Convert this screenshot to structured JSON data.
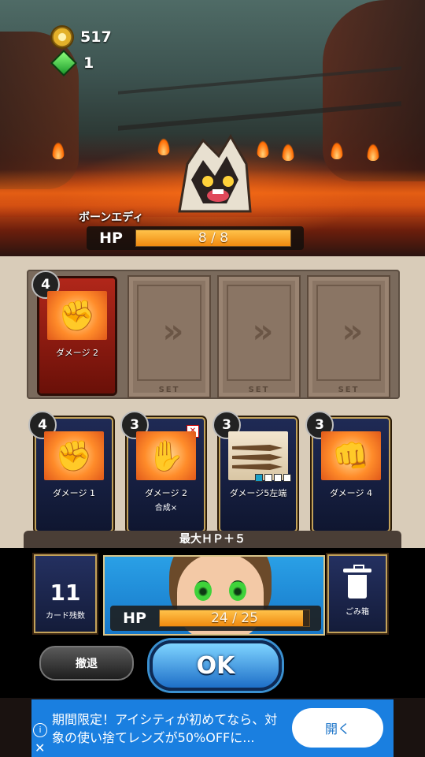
{
  "resources": {
    "coins": "517",
    "gems": "1"
  },
  "enemy": {
    "name": "ボーンエディ",
    "hp_label": "HP",
    "hp_text": "8 / 8",
    "hp_fraction": 1.0
  },
  "slots": {
    "filled": {
      "cost": "4",
      "label": "ダメージ 2",
      "icon": "fist-icon"
    },
    "empty_label": "SET",
    "arrow": "»"
  },
  "hand": [
    {
      "cost": "4",
      "label": "ダメージ 1",
      "sub": "",
      "icon": "fist-icon"
    },
    {
      "cost": "3",
      "label": "ダメージ 2",
      "sub": "合成×",
      "icon": "purple-claw-icon"
    },
    {
      "cost": "3",
      "label": "ダメージ5左端",
      "sub": "",
      "icon": "spears-icon"
    },
    {
      "cost": "3",
      "label": "ダメージ 4",
      "sub": "",
      "icon": "gauntlet-fist-icon"
    }
  ],
  "bonus_text": "最大ＨＰ＋５",
  "player": {
    "deck_count": "11",
    "deck_label": "カード残数",
    "hp_label": "HP",
    "hp_text": "24 / 25",
    "hp_fraction": 0.96,
    "trash_label": "ごみ箱"
  },
  "buttons": {
    "retreat": "撤退",
    "ok": "OK"
  },
  "ad": {
    "text": "期間限定！アイシティが初めてなら、対象の使い捨てレンズが50%OFFに...",
    "button": "開く",
    "info": "i",
    "close": "✕"
  },
  "colors": {
    "hp_fill": "#f08a10",
    "ok_button": "#1e6fc8",
    "ad_background": "#1a7fe0"
  }
}
